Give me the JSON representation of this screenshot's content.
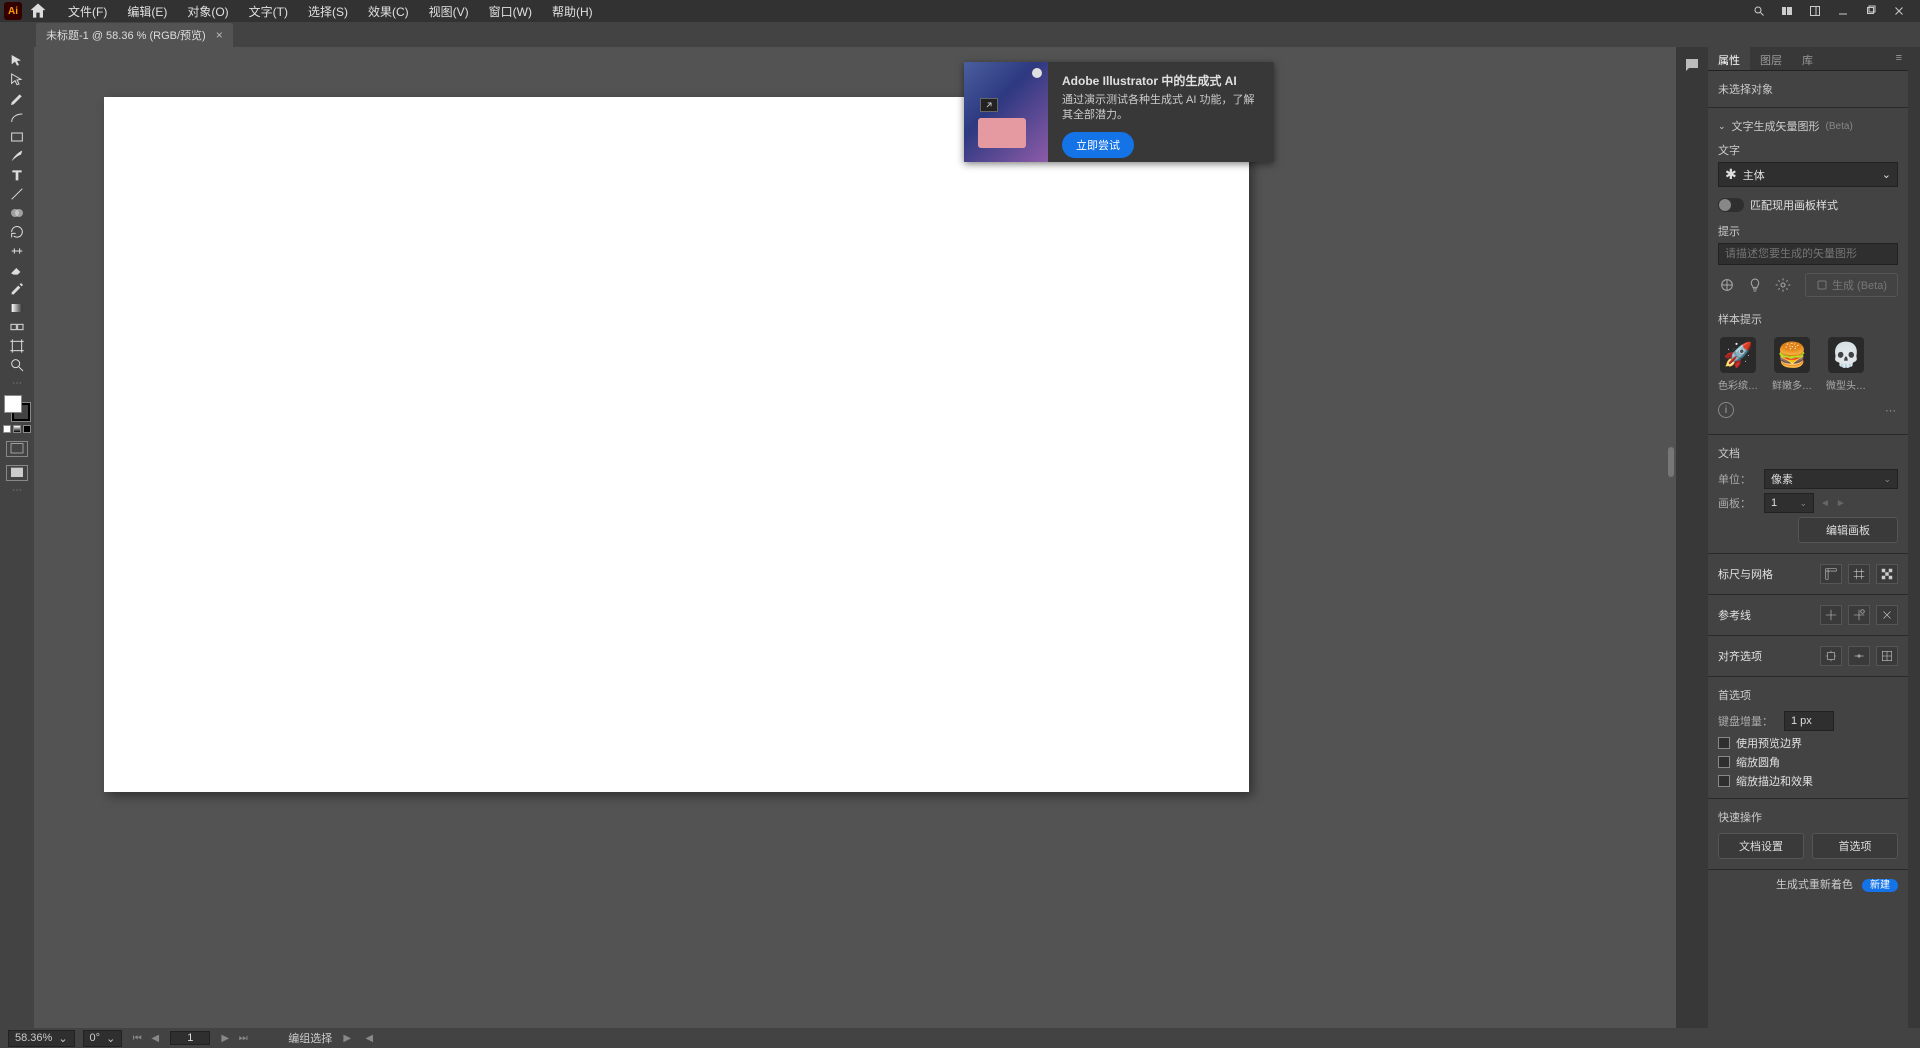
{
  "titlebar": {
    "ai_label": "Ai",
    "menus": [
      "文件(F)",
      "编辑(E)",
      "对象(O)",
      "文字(T)",
      "选择(S)",
      "效果(C)",
      "视图(V)",
      "窗口(W)",
      "帮助(H)"
    ]
  },
  "tab": {
    "title": "未标题-1 @ 58.36 % (RGB/预览)"
  },
  "popup": {
    "title": "Adobe Illustrator 中的生成式 AI",
    "desc": "通过演示测试各种生成式 AI 功能，了解其全部潜力。",
    "btn": "立即尝试"
  },
  "panel": {
    "tabs": [
      "属性",
      "图层",
      "库"
    ],
    "no_selection": "未选择对象",
    "t2v": {
      "header": "文字生成矢量图形",
      "beta": "(Beta)",
      "type_label": "文字",
      "type_value": "主体",
      "match_style": "匹配现用画板样式",
      "prompt_label": "提示",
      "prompt_placeholder": "请描述您要生成的矢量图形",
      "generate_btn": "生成 (Beta)",
      "samples_label": "样本提示",
      "samples": [
        {
          "emoji": "🚀",
          "label": "色彩缤…"
        },
        {
          "emoji": "🍔",
          "label": "鲜嫩多…"
        },
        {
          "emoji": "💀",
          "label": "微型头…"
        }
      ]
    },
    "doc": {
      "header": "文档",
      "units_label": "单位：",
      "units_value": "像素",
      "artboard_label": "画板：",
      "artboard_value": "1",
      "edit_artboard": "编辑画板"
    },
    "rulers": {
      "label": "标尺与网格"
    },
    "guides": {
      "label": "参考线"
    },
    "align": {
      "label": "对齐选项"
    },
    "prefs": {
      "header": "首选项",
      "kbd_label": "键盘增量：",
      "kbd_value": "1 px",
      "cb1": "使用预览边界",
      "cb2": "缩放圆角",
      "cb3": "缩放描边和效果"
    },
    "quick": {
      "header": "快速操作",
      "btn1": "文档设置",
      "btn2": "首选项"
    }
  },
  "status": {
    "zoom": "58.36%",
    "rotation": "0°",
    "page": "1",
    "mode": "编组选择",
    "gen_label": "生成式重新着色",
    "gen_btn": "新建"
  }
}
